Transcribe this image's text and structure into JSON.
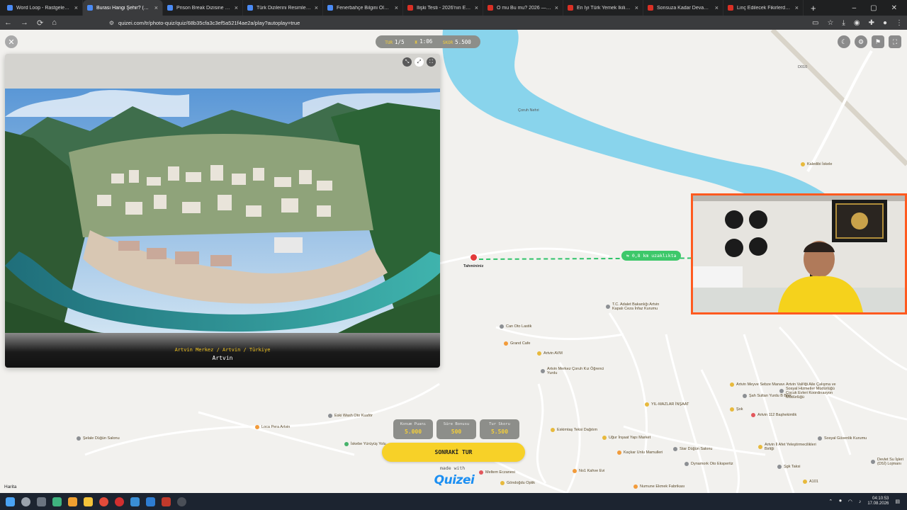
{
  "browser": {
    "tabs": [
      {
        "title": "Word Loop - Rastgele - Quizei",
        "active": false,
        "fav": "#4b8bf5"
      },
      {
        "title": "Burası Hangi Şehir? (Türkiye) - Quizei",
        "active": true,
        "fav": "#4b8bf5"
      },
      {
        "title": "Prison Break Dizisine Ne Kadar...",
        "active": false,
        "fav": "#4b8bf5"
      },
      {
        "title": "Türk Dizilerini Resimlerden Tahmin...",
        "active": false,
        "fav": "#4b8bf5"
      },
      {
        "title": "Fenerbahçe Bilgini Ölç - Quizei",
        "active": false,
        "fav": "#4b8bf5"
      },
      {
        "title": "İlişki Testi - 2026'nın En Viral Te...",
        "active": false,
        "fav": "#d93025"
      },
      {
        "title": "O mu Bu mu? 2026 — Sevgilin...",
        "active": false,
        "fav": "#d93025"
      },
      {
        "title": "En İyi Türk Yemek İkilisi Hangisi...",
        "active": false,
        "fav": "#d93025"
      },
      {
        "title": "Sonsuza Kadar Devam Edecek İl...",
        "active": false,
        "fav": "#d93025"
      },
      {
        "title": "Linç Edilecek Fikirlerden Hangisi...",
        "active": false,
        "fav": "#d93025"
      }
    ],
    "new_tab": "+",
    "url": "quizei.com/tr/photo-quiz/quiz/68b35cfa3c3ef5a521f4ae2a/play?autoplay=true"
  },
  "hud": {
    "round_label": "TUR",
    "round_value": "1/5",
    "time_value": "1:06",
    "score_label": "SKOR",
    "score_value": "5.500"
  },
  "photo": {
    "location_path": "Artvin Merkez / Artvin / Türkiye",
    "city": "Artvin"
  },
  "guess": {
    "marker_label": "Tahmininiz",
    "distance_label": "⇆ 0,8 km uzaklıkta"
  },
  "scores": [
    {
      "label": "Konum Puanı",
      "value": "5.000"
    },
    {
      "label": "Süre Bonusu",
      "value": "500"
    },
    {
      "label": "Tur Skoru",
      "value": "5.500"
    }
  ],
  "next_button": "SONRAKİ TUR",
  "made_with": "made with",
  "brand": "Quizei",
  "map_attribution": "Harita",
  "map_labels": [
    {
      "text": "Çoruh Nehri"
    },
    {
      "text": "Kaledibi İskele"
    },
    {
      "text": "D010"
    },
    {
      "text": "T.C. Adalet Bakanlığı Artvin Kapalı Ceza İnfaz Kurumu"
    },
    {
      "text": "Can Oto Lastik"
    },
    {
      "text": "Grand Cafe"
    },
    {
      "text": "Artvin AVM"
    },
    {
      "text": "Artvin Merkez Çoruh Kız Öğrenci Yurdu"
    },
    {
      "text": "YIL-MAZLAR İNŞAAT"
    },
    {
      "text": "Artvin Meyve Sebze Manavı"
    },
    {
      "text": "Şah Sultan Yurdu B Blok"
    },
    {
      "text": "Artvin Valiliği Aile Çalışma ve Sosyal Hizmetler Müdürlüğü Çocuk Evleri Koordinasyon Müdürlüğü"
    },
    {
      "text": "Şok"
    },
    {
      "text": "Artvin 112 Başhekimlik"
    },
    {
      "text": "Eski Wash Oto Kuaför"
    },
    {
      "text": "Loca Pera Artvin"
    },
    {
      "text": "Şelale Düğün Salonu"
    },
    {
      "text": "İskebe Yürüyüş Yolu"
    },
    {
      "text": "Eskimtaş Teksi Dağıtım"
    },
    {
      "text": "Uğur İnşaat Yapı Market"
    },
    {
      "text": "Kaçkar Unlu Mamulleri"
    },
    {
      "text": "Star Düğün Salonu"
    },
    {
      "text": "Artvin İl Afet Yeleştirmecilikleri Birliği"
    },
    {
      "text": "Sosyal Güvenlik Kurumu"
    },
    {
      "text": "Dynamork Oto Ekspertiz"
    },
    {
      "text": "Şgk Taksi"
    },
    {
      "text": "No1 Kahve Evi"
    },
    {
      "text": "Numune Ekmek Fabrikası"
    },
    {
      "text": "Göndoğdu Optik"
    },
    {
      "text": "Meltem Eczanesi"
    },
    {
      "text": "A101"
    },
    {
      "text": "Devlet Su İşleri (DSİ) Lojmanı"
    }
  ],
  "taskbar": {
    "time": "04:10:53",
    "date": "17.08.2026"
  },
  "colors": {
    "accent": "#f7d128",
    "distance_green": "#3dc86a",
    "guess_red": "#e23a3a",
    "cam_border": "#ff5a1f",
    "water": "#89d4ec"
  }
}
